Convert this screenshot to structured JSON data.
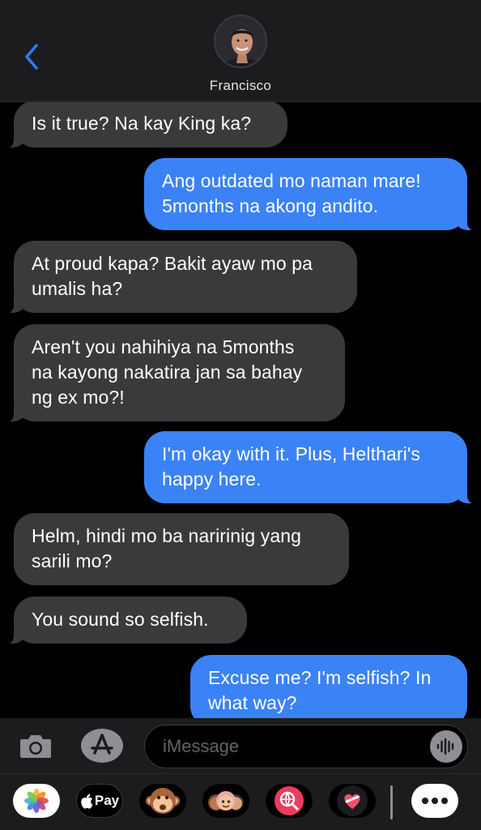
{
  "header": {
    "contact_name": "Francisco"
  },
  "messages": [
    {
      "from": "them",
      "text": "Is it true? Na kay King ka?"
    },
    {
      "from": "me",
      "text": "Ang outdated mo naman mare!\n5months na akong andito."
    },
    {
      "from": "them",
      "text": "At proud kapa? Bakit ayaw mo pa\numalis ha?"
    },
    {
      "from": "them",
      "text": "Aren't you nahihiya na 5months\nna kayong nakatira jan sa bahay\nng ex mo?!"
    },
    {
      "from": "me",
      "text": "I'm okay with it. Plus, Helthari's\nhappy here."
    },
    {
      "from": "them",
      "text": "Helm, hindi mo ba naririnig yang\nsarili mo?"
    },
    {
      "from": "them",
      "text": "You sound so selfish."
    },
    {
      "from": "me",
      "text": "Excuse me? I'm selfish? In\nwhat way?"
    }
  ],
  "composer": {
    "placeholder": "iMessage",
    "value": ""
  },
  "drawer": {
    "apps": [
      "photos-app",
      "apple-pay-app",
      "animoji-app",
      "memoji-app",
      "image-search-app",
      "digital-touch-app",
      "more-apps"
    ],
    "pay_label": "Pay"
  },
  "colors": {
    "sent_bubble": "#3b82f6",
    "received_bubble": "#3a3a3c",
    "accent": "#2f7cf6",
    "background": "#000000"
  }
}
